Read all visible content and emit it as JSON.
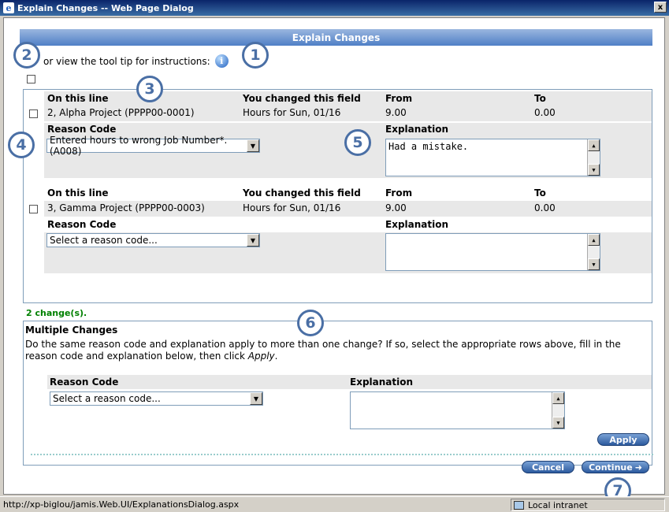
{
  "window": {
    "title": "Explain Changes -- Web Page Dialog",
    "close_symbol": "x"
  },
  "header": {
    "title": "Explain Changes"
  },
  "tooltip": {
    "text": "or view the tool tip for instructions:",
    "icon": "info-icon"
  },
  "changes": [
    {
      "on_this_line_label": "On this line",
      "field_label": "You changed this field",
      "from_label": "From",
      "to_label": "To",
      "line": "2, Alpha Project (PPPP00-0001)",
      "field": "Hours for Sun, 01/16",
      "from": "9.00",
      "to": "0.00",
      "reason_label": "Reason Code",
      "reason_value": "Entered hours to wrong Job Number*. (A008)",
      "explanation_label": "Explanation",
      "explanation_value": "Had a mistake."
    },
    {
      "on_this_line_label": "On this line",
      "field_label": "You changed this field",
      "from_label": "From",
      "to_label": "To",
      "line": "3, Gamma Project (PPPP00-0003)",
      "field": "Hours for Sun, 01/16",
      "from": "9.00",
      "to": "0.00",
      "reason_label": "Reason Code",
      "reason_value": "Select a reason code...",
      "explanation_label": "Explanation",
      "explanation_value": ""
    }
  ],
  "changes_count": "2 change(s).",
  "multiple": {
    "title": "Multiple Changes",
    "description_1": "Do the same reason code and explanation apply to more than one change? If so, select the appropriate rows above, fill in the",
    "description_2_pre": "reason code and explanation below, then click ",
    "description_2_em": "Apply",
    "description_2_post": ".",
    "reason_label": "Reason Code",
    "reason_value": "Select a reason code...",
    "explanation_label": "Explanation",
    "apply_label": "Apply"
  },
  "buttons": {
    "cancel": "Cancel",
    "continue": "Continue"
  },
  "callouts": [
    "1",
    "2",
    "3",
    "4",
    "5",
    "6",
    "7"
  ],
  "statusbar": {
    "url": "http://xp-biglou/jamis.Web.UI/ExplanationsDialog.aspx",
    "zone": "Local intranet"
  },
  "colors": {
    "header": "#4f7fc6",
    "count_green": "#008000",
    "callout": "#4a6fa5"
  }
}
